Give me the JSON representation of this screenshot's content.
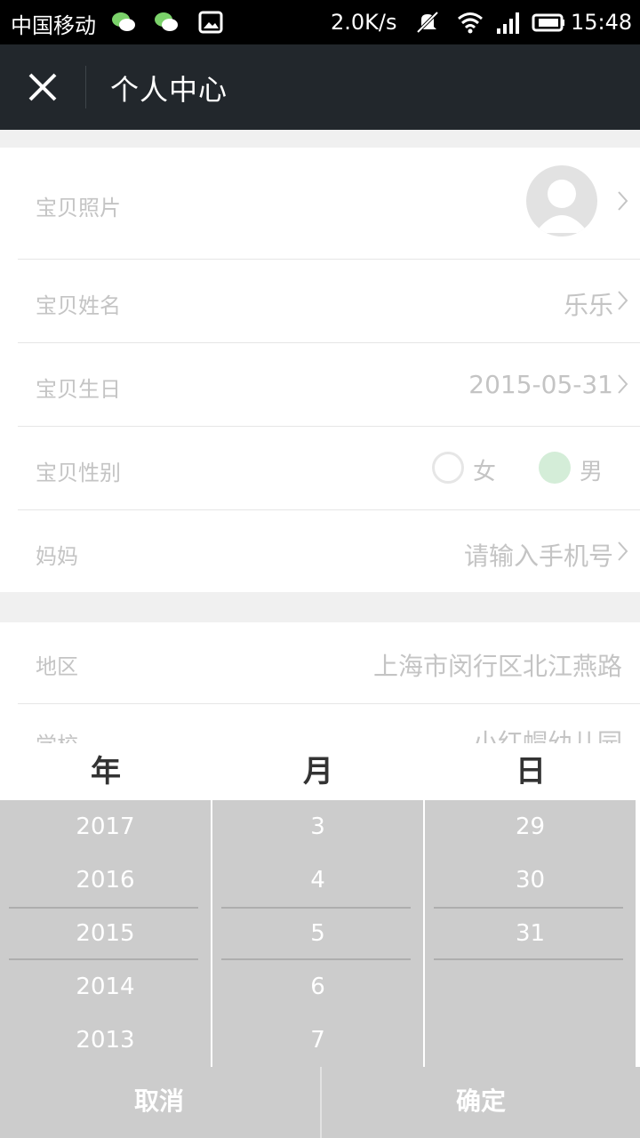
{
  "status_bar": {
    "carrier": "中国移动",
    "speed": "2.0K/s",
    "time": "15:48",
    "icons": [
      "wechat-icon",
      "wechat-icon",
      "image-icon",
      "mute-icon",
      "wifi-icon",
      "signal-icon",
      "battery-icon"
    ]
  },
  "nav": {
    "title": "个人中心",
    "close_icon": "close-icon"
  },
  "profile": {
    "photo_label": "宝贝照片",
    "name_label": "宝贝姓名",
    "name_value": "乐乐",
    "birthday_label": "宝贝生日",
    "birthday_value": "2015-05-31",
    "gender_label": "宝贝性别",
    "gender_options": [
      "女",
      "男"
    ],
    "gender_selected": "男",
    "mother_label": "妈妈",
    "mother_placeholder": "请输入手机号"
  },
  "location": {
    "region_label": "地区",
    "region_value": "上海市闵行区北江燕路",
    "school_label": "学校",
    "school_value": "小红帽幼儿园"
  },
  "picker": {
    "headers": [
      "年",
      "月",
      "日"
    ],
    "years": [
      "2017",
      "2016",
      "2015",
      "2014",
      "2013"
    ],
    "months": [
      "3",
      "4",
      "5",
      "6",
      "7"
    ],
    "days": [
      "29",
      "30",
      "31"
    ],
    "selected": {
      "year": "2015",
      "month": "5",
      "day": "31"
    },
    "cancel_label": "取消",
    "confirm_label": "确定"
  },
  "colors": {
    "nav_bg": "#22272c",
    "picker_bg": "#cccccc",
    "selected_radio": "#d4edd8"
  }
}
